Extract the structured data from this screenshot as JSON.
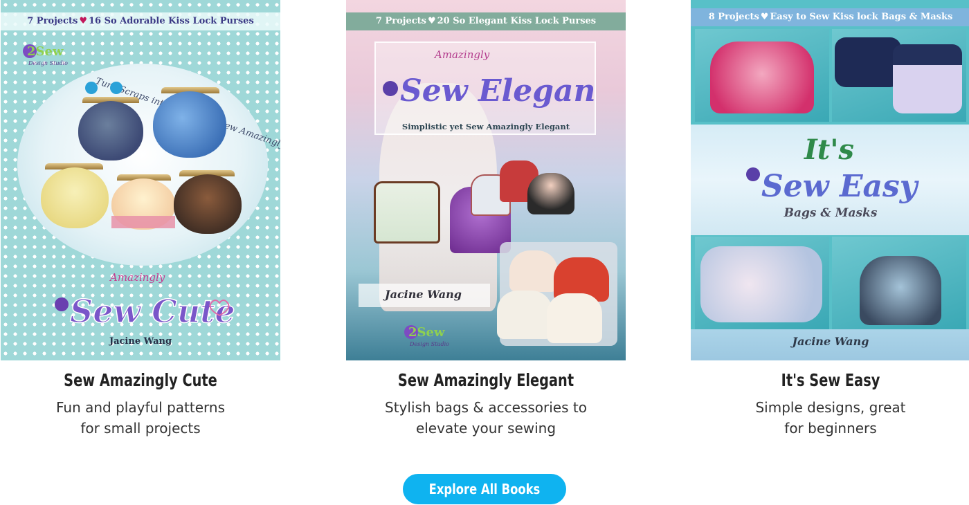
{
  "books": [
    {
      "title": "Sew Amazingly Cute",
      "description_lines": [
        "Fun and playful patterns",
        "for small projects"
      ],
      "cover": {
        "banner_left": "7 Projects",
        "banner_right": "16 So Adorable Kiss Lock Purses",
        "tagline": "Turn Scraps into something Sew Amazingly Cute",
        "script_word": "Amazingly",
        "title_art_text": "Sew Cute",
        "author": "Jacine Wang",
        "logo_text": "2Sew",
        "logo_subtext": "Design Studio"
      }
    },
    {
      "title": "Sew Amazingly Elegant",
      "description_lines": [
        "Stylish bags & accessories to",
        "elevate your sewing"
      ],
      "cover": {
        "banner_left": "7 Projects",
        "banner_right": "20 So Elegant Kiss Lock Purses",
        "script_word": "Amazingly",
        "title_art_text": "Sew Elegant",
        "subtitle": "Simplistic yet Sew Amazingly Elegant",
        "author": "Jacine Wang",
        "logo_text": "2Sew",
        "logo_subtext": "Design Studio"
      }
    },
    {
      "title": "It's Sew Easy",
      "description_lines": [
        "Simple designs, great",
        "for beginners"
      ],
      "cover": {
        "banner_left": "8 Projects",
        "banner_right": "Easy to Sew Kiss lock Bags & Masks",
        "title_art_line1": "It's",
        "title_art_line2": "Sew Easy",
        "subtitle": "Bags & Masks",
        "author": "Jacine Wang"
      }
    }
  ],
  "cta": {
    "label": "Explore All Books"
  },
  "colors": {
    "button": "#0fb3f0",
    "heart": "#c2185b"
  }
}
